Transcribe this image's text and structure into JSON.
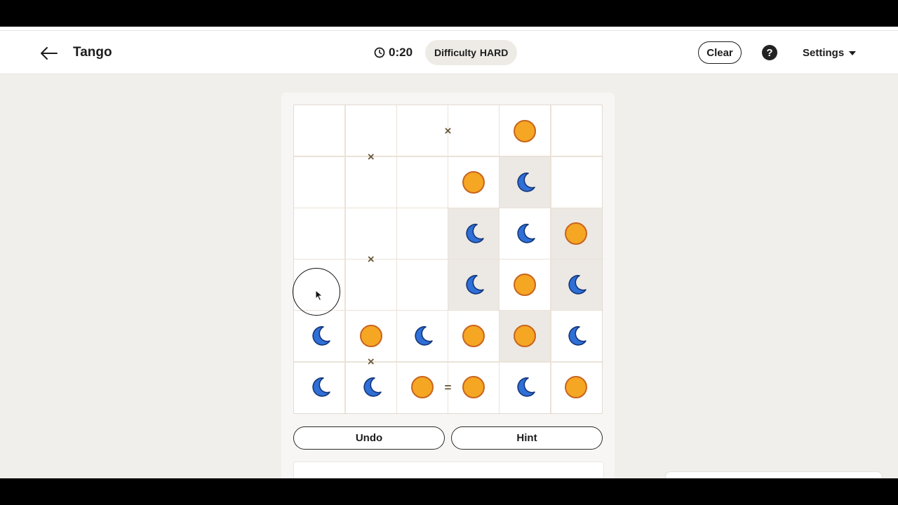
{
  "header": {
    "title": "Tango",
    "timer": "0:20",
    "difficulty_label": "Difficulty",
    "difficulty_value": "HARD",
    "clear_label": "Clear",
    "help_label": "?",
    "settings_label": "Settings"
  },
  "board": {
    "size": 6,
    "symbols": {
      "sun": "sun-icon",
      "moon": "moon-icon"
    },
    "colors": {
      "sun": "#f5a623",
      "sun_border": "#c8641e",
      "moon": "#2f6fd6",
      "moon_border": "#14367a",
      "shaded_cell": "#ece8e4"
    },
    "rows": [
      [
        "",
        "",
        "",
        "",
        "sun",
        ""
      ],
      [
        "",
        "",
        "",
        "sun",
        "moon",
        ""
      ],
      [
        "",
        "",
        "",
        "moon",
        "moon",
        "sun"
      ],
      [
        "",
        "",
        "",
        "moon",
        "sun",
        "moon"
      ],
      [
        "moon",
        "sun",
        "moon",
        "sun",
        "sun",
        "moon"
      ],
      [
        "moon",
        "moon",
        "sun",
        "sun",
        "moon",
        "sun"
      ]
    ],
    "shaded": [
      [
        1,
        4
      ],
      [
        2,
        3
      ],
      [
        2,
        5
      ],
      [
        3,
        3
      ],
      [
        3,
        5
      ],
      [
        4,
        4
      ]
    ],
    "constraints": [
      {
        "type": "×",
        "between": [
          [
            0,
            1
          ],
          [
            1,
            1
          ]
        ]
      },
      {
        "type": "×",
        "between": [
          [
            0,
            2
          ],
          [
            0,
            3
          ]
        ]
      },
      {
        "type": "×",
        "between": [
          [
            2,
            1
          ],
          [
            3,
            1
          ]
        ]
      },
      {
        "type": "×",
        "between": [
          [
            4,
            1
          ],
          [
            5,
            1
          ]
        ]
      },
      {
        "type": "=",
        "between": [
          [
            5,
            2
          ],
          [
            5,
            3
          ]
        ]
      }
    ]
  },
  "controls": {
    "undo_label": "Undo",
    "hint_label": "Hint"
  }
}
